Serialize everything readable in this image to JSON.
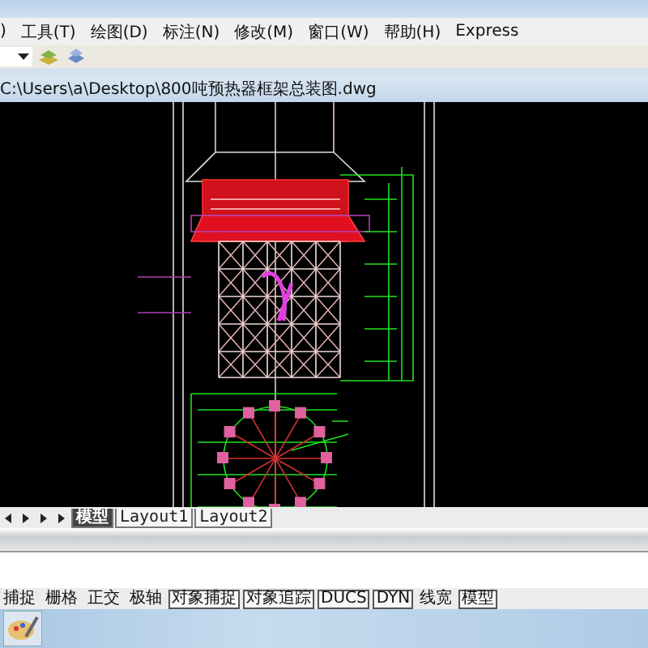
{
  "menu_bar": {
    "items": [
      ")",
      "工具(T)",
      "绘图(D)",
      "标注(N)",
      "修改(M)",
      "窗口(W)",
      "帮助(H)",
      "Express"
    ]
  },
  "document": {
    "title": "C:\\Users\\a\\Desktop\\800吨预热器框架总装图.dwg"
  },
  "layout_tabs": [
    {
      "label": "模型",
      "selected": true
    },
    {
      "label": "Layout1",
      "selected": false
    },
    {
      "label": "Layout2",
      "selected": false
    }
  ],
  "status_toggles": [
    {
      "label": "捕捉",
      "on": false
    },
    {
      "label": "栅格",
      "on": false
    },
    {
      "label": "正交",
      "on": false
    },
    {
      "label": "极轴",
      "on": false
    },
    {
      "label": "对象捕捉",
      "on": true
    },
    {
      "label": "对象追踪",
      "on": true
    },
    {
      "label": "DUCS",
      "on": true
    },
    {
      "label": "DYN",
      "on": true
    },
    {
      "label": "线宽",
      "on": false
    },
    {
      "label": "模型",
      "on": true
    }
  ]
}
